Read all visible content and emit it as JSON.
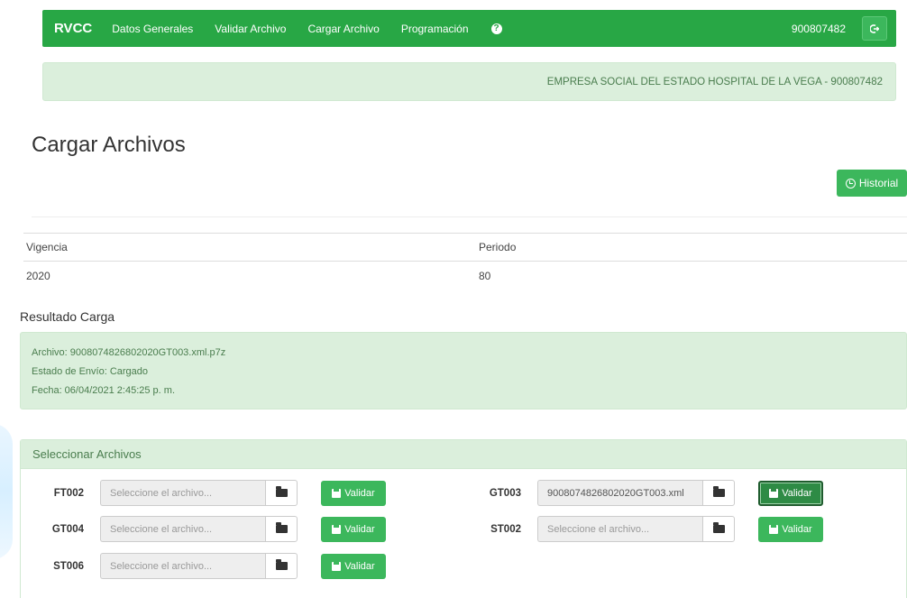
{
  "navbar": {
    "brand": "RVCC",
    "items": [
      {
        "label": "Datos Generales"
      },
      {
        "label": "Validar Archivo"
      },
      {
        "label": "Cargar Archivo"
      },
      {
        "label": "Programación"
      }
    ],
    "help_icon": "question-circle-icon",
    "user": "900807482",
    "logout_icon": "sign-out-icon"
  },
  "entity_banner": "EMPRESA SOCIAL DEL ESTADO HOSPITAL DE LA VEGA - 900807482",
  "page_title": "Cargar Archivos",
  "historial_button": "Historial",
  "info_table": {
    "headers": [
      "Vigencia",
      "Periodo"
    ],
    "values": [
      "2020",
      "80"
    ]
  },
  "resultado": {
    "title": "Resultado Carga",
    "archivo": "Archivo: 9008074826802020GT003.xml.p7z",
    "estado": "Estado de Envío: Cargado",
    "fecha": "Fecha: 06/04/2021 2:45:25 p. m."
  },
  "panel": {
    "title": "Seleccionar Archivos",
    "placeholder": "Seleccione el archivo...",
    "validar_label": "Validar",
    "files": [
      {
        "code": "FT002",
        "value": ""
      },
      {
        "code": "GT003",
        "value": "9008074826802020GT003.xml"
      },
      {
        "code": "GT004",
        "value": ""
      },
      {
        "code": "ST002",
        "value": ""
      },
      {
        "code": "ST006",
        "value": ""
      }
    ]
  },
  "colors": {
    "primary": "#28a745",
    "button": "#3cb75c",
    "alert_bg": "#dbefdc",
    "alert_text": "#4a7d4e"
  }
}
